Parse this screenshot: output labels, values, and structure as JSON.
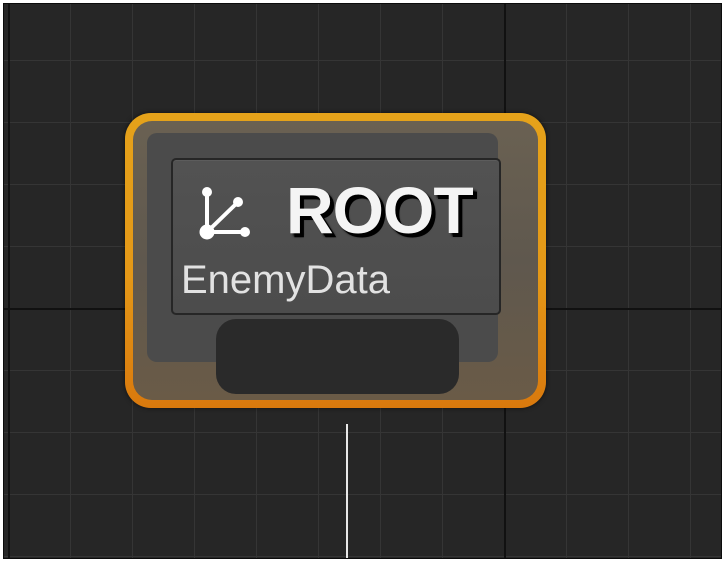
{
  "graph": {
    "root_node": {
      "title": "ROOT",
      "subtitle": "EnemyData",
      "icon": "tree-branch-icon",
      "state": "selected",
      "accent_color": "#e49a17"
    },
    "colors": {
      "canvas_background": "#262626",
      "grid_line": "#353535",
      "grid_major_line": "#111111",
      "wire": "#e8e8e8"
    }
  }
}
